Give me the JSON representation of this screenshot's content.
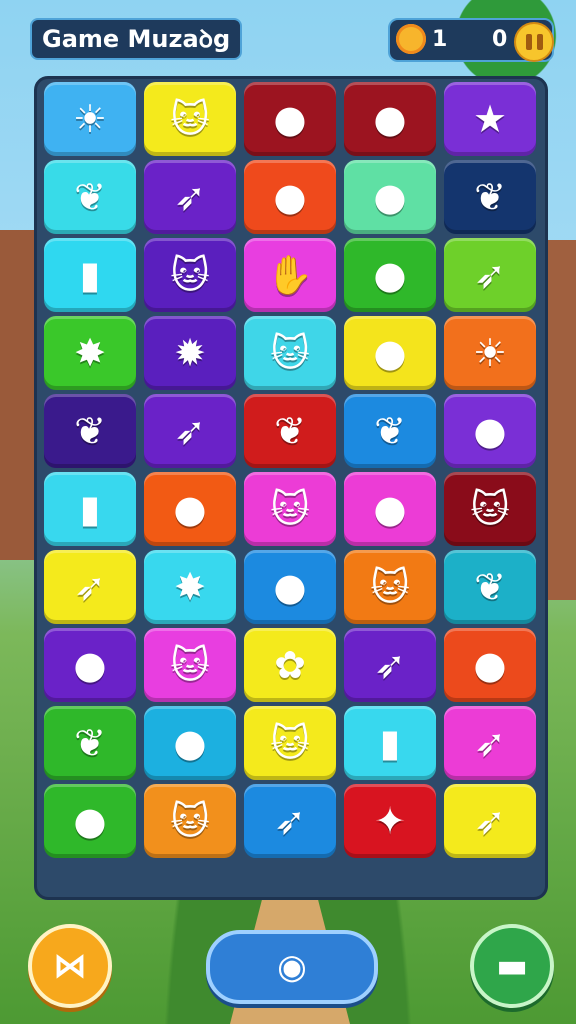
{
  "header": {
    "title": "Game Muzaꝺg",
    "score_left": "1",
    "score_right": "0",
    "sun_icon": "sun-icon",
    "pause_icon": "pause-icon"
  },
  "board": {
    "rows": [
      [
        {
          "color": "#3fb2f2",
          "icon": "sun-creature",
          "glyph": "☀"
        },
        {
          "color": "#f4ea1c",
          "icon": "cat-face",
          "glyph": "🐱"
        },
        {
          "color": "#9c1420",
          "icon": "bird-face",
          "glyph": "●"
        },
        {
          "color": "#9c1420",
          "icon": "fish-face",
          "glyph": "●"
        },
        {
          "color": "#7a2fd6",
          "icon": "star",
          "glyph": "★"
        }
      ],
      [
        {
          "color": "#38dbe8",
          "icon": "leaf",
          "glyph": "❦"
        },
        {
          "color": "#6a22c8",
          "icon": "arrow",
          "glyph": "➶"
        },
        {
          "color": "#ef4a1c",
          "icon": "pig-face",
          "glyph": "●"
        },
        {
          "color": "#5fe0a4",
          "icon": "fish",
          "glyph": "●"
        },
        {
          "color": "#14356e",
          "icon": "flame-leaf",
          "glyph": "❦"
        }
      ],
      [
        {
          "color": "#2fd8f0",
          "icon": "dynamite",
          "glyph": "▮"
        },
        {
          "color": "#5a1fbe",
          "icon": "cat-face",
          "glyph": "🐱"
        },
        {
          "color": "#e83ee0",
          "icon": "hand",
          "glyph": "✋"
        },
        {
          "color": "#2fb82a",
          "icon": "berry-stick",
          "glyph": "●"
        },
        {
          "color": "#6ed02a",
          "icon": "leaf-stick",
          "glyph": "➶"
        }
      ],
      [
        {
          "color": "#3ac82a",
          "icon": "splat",
          "glyph": "✸"
        },
        {
          "color": "#5a1fbe",
          "icon": "puffer-fish",
          "glyph": "✹"
        },
        {
          "color": "#3fd6e8",
          "icon": "cat-face",
          "glyph": "🐱"
        },
        {
          "color": "#f4e41c",
          "icon": "cat-blob",
          "glyph": "●"
        },
        {
          "color": "#f2701c",
          "icon": "sun-face",
          "glyph": "☀"
        }
      ],
      [
        {
          "color": "#3a1a8c",
          "icon": "leaf",
          "glyph": "❦"
        },
        {
          "color": "#6a22c8",
          "icon": "arrow",
          "glyph": "➶"
        },
        {
          "color": "#d01c1c",
          "icon": "flame-leaf",
          "glyph": "❦"
        },
        {
          "color": "#1c8ae0",
          "icon": "shell",
          "glyph": "❦"
        },
        {
          "color": "#7a2fd6",
          "icon": "berry-stick",
          "glyph": "●"
        }
      ],
      [
        {
          "color": "#38d8ee",
          "icon": "bottle",
          "glyph": "▮"
        },
        {
          "color": "#f25a14",
          "icon": "cat-blob",
          "glyph": "●"
        },
        {
          "color": "#ec3cd6",
          "icon": "cat-face",
          "glyph": "🐱"
        },
        {
          "color": "#ec3cd6",
          "icon": "berry-fish",
          "glyph": "●"
        },
        {
          "color": "#8a0c1a",
          "icon": "cat-face",
          "glyph": "🐱"
        }
      ],
      [
        {
          "color": "#f4ea1c",
          "icon": "bird",
          "glyph": "➶"
        },
        {
          "color": "#38d8ee",
          "icon": "star-flower",
          "glyph": "✸"
        },
        {
          "color": "#1c8ae0",
          "icon": "chick",
          "glyph": "●"
        },
        {
          "color": "#f27a14",
          "icon": "cat-face",
          "glyph": "🐱"
        },
        {
          "color": "#1cb0c8",
          "icon": "leaf",
          "glyph": "❦"
        }
      ],
      [
        {
          "color": "#6a22c8",
          "icon": "cat-blob",
          "glyph": "●"
        },
        {
          "color": "#e83ee0",
          "icon": "cat-face",
          "glyph": "🐱"
        },
        {
          "color": "#f4ea1c",
          "icon": "flower-arrow",
          "glyph": "✿"
        },
        {
          "color": "#6a22c8",
          "icon": "arrow",
          "glyph": "➶"
        },
        {
          "color": "#ec4a1c",
          "icon": "blob",
          "glyph": "●"
        }
      ],
      [
        {
          "color": "#2fb82a",
          "icon": "shell",
          "glyph": "❦"
        },
        {
          "color": "#1cb0e0",
          "icon": "frog",
          "glyph": "●"
        },
        {
          "color": "#f4ea1c",
          "icon": "cat-face",
          "glyph": "🐱"
        },
        {
          "color": "#38d8ee",
          "icon": "bottle",
          "glyph": "▮"
        },
        {
          "color": "#ec3cd6",
          "icon": "leaf-stick",
          "glyph": "➶"
        }
      ],
      [
        {
          "color": "#2fb82a",
          "icon": "berry-bird",
          "glyph": "●"
        },
        {
          "color": "#f2901c",
          "icon": "cat-face",
          "glyph": "🐱"
        },
        {
          "color": "#1c8ae0",
          "icon": "orange-arrow",
          "glyph": "➶"
        },
        {
          "color": "#d81420",
          "icon": "shell",
          "glyph": "✦"
        },
        {
          "color": "#f4ea1c",
          "icon": "fish",
          "glyph": "➶"
        }
      ]
    ]
  },
  "footer": {
    "left_icon": "map-icon",
    "center_icon": "refresh-icon",
    "right_icon": "chat-icon"
  }
}
